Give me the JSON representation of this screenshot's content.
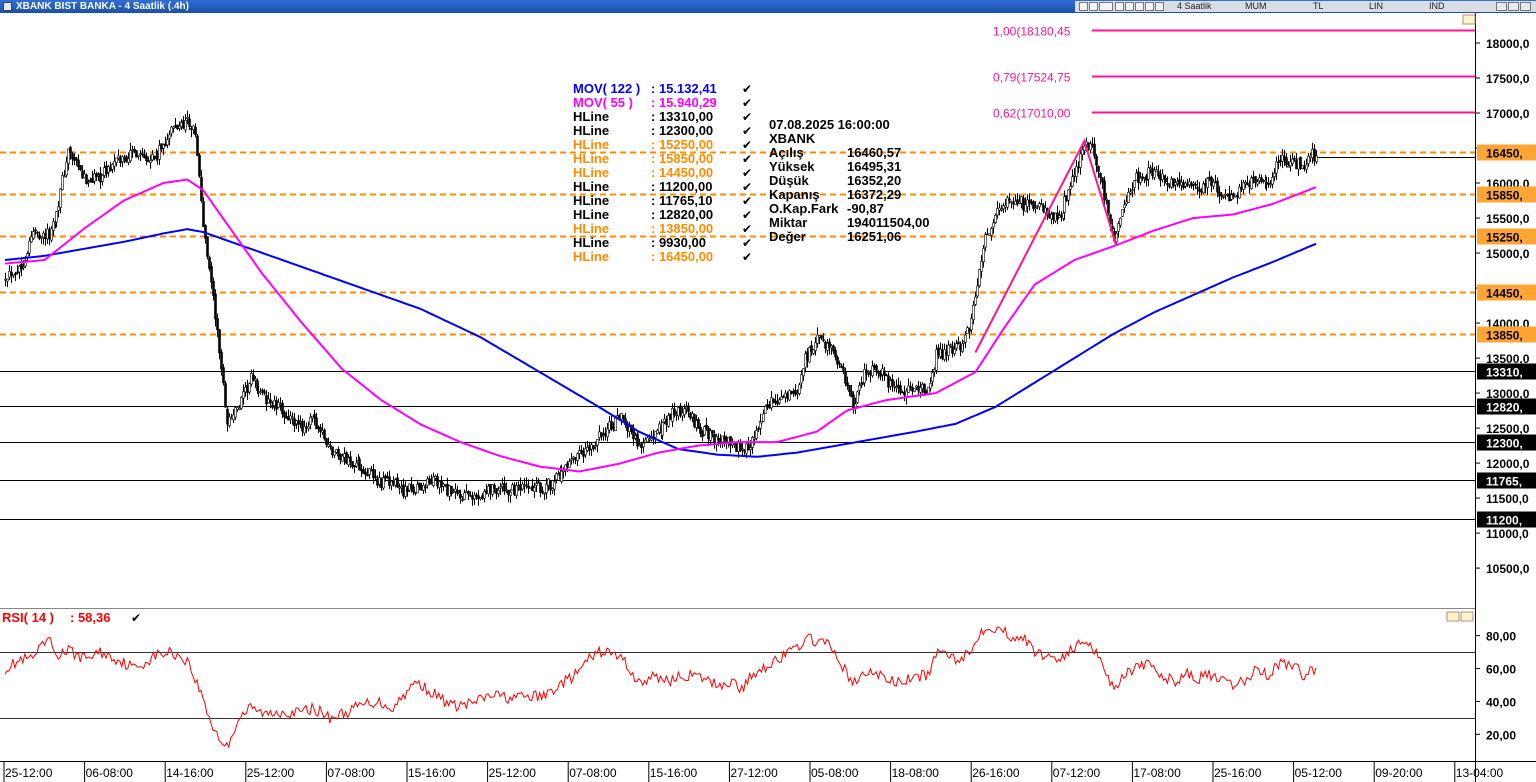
{
  "window": {
    "title": "XBANK BIST BANKA - 4 Saatlik (.4h)",
    "toolbar": {
      "period": "4 Saatlik",
      "style": "MUM",
      "currency": "TL",
      "scale": "LIN",
      "mode": "IND"
    }
  },
  "legend": {
    "mov122": {
      "label": "MOV( 122 )",
      "value": ": 15.132,41",
      "color": "#0000ff"
    },
    "mov55": {
      "label": "MOV( 55 )",
      "value": ": 15.940,29",
      "color": "#ff00ff"
    },
    "hlines": [
      {
        "label": "HLine",
        "value": ": 13310,00",
        "color": "#000000"
      },
      {
        "label": "HLine",
        "value": ": 12300,00",
        "color": "#000000"
      },
      {
        "label": "HLine",
        "value": ": 15250,00",
        "color": "#ff8c00"
      },
      {
        "label": "HLine",
        "value": ": 15850,00",
        "color": "#ff8c00"
      },
      {
        "label": "HLine",
        "value": ": 14450,00",
        "color": "#ff8c00"
      },
      {
        "label": "HLine",
        "value": ": 11200,00",
        "color": "#000000"
      },
      {
        "label": "HLine",
        "value": ": 11765,10",
        "color": "#000000"
      },
      {
        "label": "HLine",
        "value": ": 12820,00",
        "color": "#000000"
      },
      {
        "label": "HLine",
        "value": ": 13850,00",
        "color": "#ff8c00"
      },
      {
        "label": "HLine",
        "value": ": 9930,00",
        "color": "#000000"
      },
      {
        "label": "HLine",
        "value": ": 16450,00",
        "color": "#ff8c00"
      }
    ],
    "check": "✔"
  },
  "info": {
    "datetime": "07.08.2025  16:00:00",
    "symbol": "XBANK",
    "rows": [
      {
        "k": "Açılış",
        "v": "16460,57"
      },
      {
        "k": "Yüksek",
        "v": "16495,31"
      },
      {
        "k": "Düşük",
        "v": "16352,20"
      },
      {
        "k": "Kapanış",
        "v": "16372,29"
      },
      {
        "k": "O.Kap.Fark",
        "v": "-90,87"
      },
      {
        "k": "Miktar",
        "v": "194011504,00"
      },
      {
        "k": "Değer",
        "v": "16251,06"
      }
    ]
  },
  "rsi_legend": {
    "label": "RSI( 14 )",
    "value": ": 58,36",
    "color": "#ff0000"
  },
  "chart_data": {
    "type": "candlestick",
    "price_axis": {
      "ylim": [
        9930,
        18400
      ],
      "ticks": [
        18000,
        17500,
        17000,
        16500,
        16000,
        15500,
        15000,
        14500,
        14000,
        13500,
        13000,
        12500,
        12000,
        11500,
        11000,
        10500
      ],
      "tick_labels": [
        "18000,0",
        "17500,0",
        "17000,0",
        "16500,0",
        "16000,0",
        "15500,0",
        "15000,0",
        "14500,0",
        "14000,0",
        "13500,0",
        "13000,0",
        "12500,0",
        "12000,0",
        "11500,0",
        "11000,0",
        "10500,0"
      ]
    },
    "x_labels": [
      "25-12:00",
      "06-08:00",
      "14-16:00",
      "25-12:00",
      "07-08:00",
      "15-16:00",
      "25-12:00",
      "07-08:00",
      "15-16:00",
      "27-12:00",
      "05-08:00",
      "18-08:00",
      "26-16:00",
      "07-12:00",
      "17-08:00",
      "25-16:00",
      "05-12:00",
      "09-20:00",
      "13-04:00"
    ],
    "fibonacci": [
      {
        "label": "1,00(18180,45",
        "value": 18180.45
      },
      {
        "label": "0,79(17524,75",
        "value": 17524.75
      },
      {
        "label": "0,62(17010,00",
        "value": 17010.0
      }
    ],
    "hlines": [
      {
        "value": 16450,
        "label": "16450,",
        "color": "#ff8c00",
        "style": "dashed"
      },
      {
        "value": 15850,
        "label": "15850,",
        "color": "#ff8c00",
        "style": "dashed"
      },
      {
        "value": 15250,
        "label": "15250,",
        "color": "#ff8c00",
        "style": "dashed"
      },
      {
        "value": 14450,
        "label": "14450,",
        "color": "#ff8c00",
        "style": "dashed"
      },
      {
        "value": 13850,
        "label": "13850,",
        "color": "#ff8c00",
        "style": "dashed"
      },
      {
        "value": 13310,
        "label": "13310,",
        "color": "#000000",
        "style": "solid"
      },
      {
        "value": 12820,
        "label": "12820,",
        "color": "#000000",
        "style": "solid"
      },
      {
        "value": 12300,
        "label": "12300,",
        "color": "#000000",
        "style": "solid"
      },
      {
        "value": 11765,
        "label": "11765,",
        "color": "#000000",
        "style": "solid"
      },
      {
        "value": 11200,
        "label": "11200,",
        "color": "#000000",
        "style": "solid"
      }
    ],
    "close_keypoints": [
      [
        0,
        14700
      ],
      [
        8,
        14800
      ],
      [
        14,
        15300
      ],
      [
        22,
        15250
      ],
      [
        26,
        15600
      ],
      [
        32,
        16450
      ],
      [
        40,
        16050
      ],
      [
        48,
        16100
      ],
      [
        56,
        16300
      ],
      [
        66,
        16450
      ],
      [
        76,
        16350
      ],
      [
        84,
        16750
      ],
      [
        92,
        16900
      ],
      [
        96,
        16700
      ],
      [
        100,
        15400
      ],
      [
        104,
        14600
      ],
      [
        108,
        13600
      ],
      [
        112,
        12600
      ],
      [
        118,
        12800
      ],
      [
        124,
        13200
      ],
      [
        132,
        12900
      ],
      [
        140,
        12750
      ],
      [
        148,
        12500
      ],
      [
        156,
        12600
      ],
      [
        164,
        12200
      ],
      [
        172,
        12050
      ],
      [
        180,
        11950
      ],
      [
        188,
        11750
      ],
      [
        196,
        11700
      ],
      [
        202,
        11600
      ],
      [
        208,
        11650
      ],
      [
        216,
        11750
      ],
      [
        226,
        11550
      ],
      [
        236,
        11500
      ],
      [
        246,
        11650
      ],
      [
        256,
        11600
      ],
      [
        264,
        11620
      ],
      [
        272,
        11650
      ],
      [
        280,
        11800
      ],
      [
        288,
        12050
      ],
      [
        296,
        12200
      ],
      [
        302,
        12450
      ],
      [
        312,
        12650
      ],
      [
        320,
        12250
      ],
      [
        328,
        12400
      ],
      [
        336,
        12700
      ],
      [
        344,
        12750
      ],
      [
        352,
        12450
      ],
      [
        360,
        12350
      ],
      [
        368,
        12250
      ],
      [
        372,
        12150
      ],
      [
        378,
        12350
      ],
      [
        386,
        12850
      ],
      [
        394,
        12950
      ],
      [
        400,
        13000
      ],
      [
        404,
        13500
      ],
      [
        410,
        13750
      ],
      [
        416,
        13700
      ],
      [
        422,
        13350
      ],
      [
        428,
        12800
      ],
      [
        432,
        13150
      ],
      [
        436,
        13350
      ],
      [
        442,
        13300
      ],
      [
        448,
        13050
      ],
      [
        454,
        13000
      ],
      [
        460,
        13100
      ],
      [
        466,
        13000
      ],
      [
        470,
        13550
      ],
      [
        476,
        13600
      ],
      [
        480,
        13650
      ],
      [
        484,
        13750
      ],
      [
        488,
        14000
      ],
      [
        492,
        14800
      ],
      [
        496,
        15300
      ],
      [
        502,
        15600
      ],
      [
        508,
        15800
      ],
      [
        514,
        15700
      ],
      [
        520,
        15650
      ],
      [
        526,
        15600
      ],
      [
        532,
        15500
      ],
      [
        540,
        16100
      ],
      [
        544,
        16500
      ],
      [
        548,
        16550
      ],
      [
        552,
        16200
      ],
      [
        556,
        15700
      ],
      [
        560,
        15200
      ],
      [
        564,
        15600
      ],
      [
        570,
        16050
      ],
      [
        578,
        16150
      ],
      [
        584,
        16100
      ],
      [
        590,
        15950
      ],
      [
        596,
        16000
      ],
      [
        602,
        15900
      ],
      [
        608,
        16050
      ],
      [
        614,
        15850
      ],
      [
        620,
        15800
      ],
      [
        626,
        15950
      ],
      [
        632,
        16100
      ],
      [
        638,
        16000
      ],
      [
        644,
        16350
      ],
      [
        650,
        16300
      ],
      [
        656,
        16250
      ],
      [
        660,
        16400
      ],
      [
        662,
        16372.29
      ]
    ],
    "mov122_keypoints": [
      [
        0,
        14900
      ],
      [
        20,
        14960
      ],
      [
        40,
        15060
      ],
      [
        60,
        15160
      ],
      [
        80,
        15280
      ],
      [
        92,
        15340
      ],
      [
        100,
        15300
      ],
      [
        120,
        15100
      ],
      [
        150,
        14800
      ],
      [
        180,
        14500
      ],
      [
        210,
        14200
      ],
      [
        240,
        13800
      ],
      [
        270,
        13300
      ],
      [
        300,
        12800
      ],
      [
        320,
        12450
      ],
      [
        340,
        12200
      ],
      [
        360,
        12120
      ],
      [
        380,
        12090
      ],
      [
        400,
        12150
      ],
      [
        420,
        12250
      ],
      [
        440,
        12350
      ],
      [
        460,
        12450
      ],
      [
        480,
        12560
      ],
      [
        500,
        12800
      ],
      [
        520,
        13150
      ],
      [
        540,
        13500
      ],
      [
        560,
        13850
      ],
      [
        580,
        14150
      ],
      [
        600,
        14400
      ],
      [
        620,
        14650
      ],
      [
        640,
        14870
      ],
      [
        662,
        15132.41
      ]
    ],
    "mov55_keypoints": [
      [
        0,
        14850
      ],
      [
        20,
        14900
      ],
      [
        40,
        15350
      ],
      [
        60,
        15750
      ],
      [
        80,
        16000
      ],
      [
        92,
        16050
      ],
      [
        100,
        15900
      ],
      [
        110,
        15500
      ],
      [
        130,
        14700
      ],
      [
        150,
        14000
      ],
      [
        170,
        13350
      ],
      [
        190,
        12900
      ],
      [
        210,
        12550
      ],
      [
        230,
        12300
      ],
      [
        250,
        12100
      ],
      [
        270,
        11950
      ],
      [
        290,
        11880
      ],
      [
        310,
        11990
      ],
      [
        330,
        12150
      ],
      [
        350,
        12250
      ],
      [
        370,
        12300
      ],
      [
        390,
        12300
      ],
      [
        410,
        12450
      ],
      [
        425,
        12750
      ],
      [
        445,
        12900
      ],
      [
        470,
        13000
      ],
      [
        490,
        13300
      ],
      [
        505,
        13950
      ],
      [
        520,
        14550
      ],
      [
        540,
        14900
      ],
      [
        560,
        15100
      ],
      [
        580,
        15320
      ],
      [
        600,
        15500
      ],
      [
        620,
        15550
      ],
      [
        640,
        15700
      ],
      [
        662,
        15940.29
      ]
    ],
    "zigzag": [
      [
        490,
        13580
      ],
      [
        545,
        16600
      ],
      [
        561,
        15120
      ]
    ],
    "rsi": {
      "ticks": [
        80,
        60,
        40,
        20
      ],
      "tick_labels": [
        "80,00",
        "60,00",
        "40,00",
        "20,00"
      ],
      "levels": [
        70,
        30
      ],
      "ylim": [
        5,
        95
      ],
      "keypoints": [
        [
          0,
          60
        ],
        [
          8,
          65
        ],
        [
          14,
          66
        ],
        [
          22,
          78
        ],
        [
          26,
          68
        ],
        [
          32,
          71
        ],
        [
          40,
          66
        ],
        [
          48,
          70
        ],
        [
          56,
          66
        ],
        [
          66,
          60
        ],
        [
          76,
          68
        ],
        [
          84,
          70
        ],
        [
          92,
          65
        ],
        [
          100,
          42
        ],
        [
          104,
          27
        ],
        [
          108,
          18
        ],
        [
          112,
          12
        ],
        [
          118,
          30
        ],
        [
          124,
          36
        ],
        [
          132,
          32
        ],
        [
          140,
          34
        ],
        [
          148,
          33
        ],
        [
          156,
          36
        ],
        [
          164,
          30
        ],
        [
          172,
          33
        ],
        [
          180,
          38
        ],
        [
          188,
          40
        ],
        [
          196,
          36
        ],
        [
          202,
          45
        ],
        [
          208,
          52
        ],
        [
          216,
          45
        ],
        [
          226,
          37
        ],
        [
          236,
          39
        ],
        [
          246,
          44
        ],
        [
          256,
          42
        ],
        [
          264,
          43
        ],
        [
          272,
          43
        ],
        [
          280,
          50
        ],
        [
          288,
          56
        ],
        [
          296,
          67
        ],
        [
          302,
          71
        ],
        [
          312,
          66
        ],
        [
          320,
          51
        ],
        [
          328,
          55
        ],
        [
          336,
          53
        ],
        [
          344,
          56
        ],
        [
          352,
          54
        ],
        [
          360,
          50
        ],
        [
          368,
          52
        ],
        [
          372,
          47
        ],
        [
          378,
          57
        ],
        [
          386,
          63
        ],
        [
          394,
          68
        ],
        [
          400,
          73
        ],
        [
          404,
          78
        ],
        [
          410,
          77
        ],
        [
          416,
          74
        ],
        [
          422,
          64
        ],
        [
          428,
          50
        ],
        [
          432,
          55
        ],
        [
          436,
          58
        ],
        [
          442,
          56
        ],
        [
          448,
          52
        ],
        [
          454,
          52
        ],
        [
          460,
          55
        ],
        [
          466,
          56
        ],
        [
          470,
          68
        ],
        [
          476,
          70
        ],
        [
          480,
          66
        ],
        [
          484,
          68
        ],
        [
          488,
          70
        ],
        [
          492,
          82
        ],
        [
          496,
          86
        ],
        [
          502,
          84
        ],
        [
          508,
          80
        ],
        [
          514,
          79
        ],
        [
          520,
          70
        ],
        [
          526,
          68
        ],
        [
          532,
          66
        ],
        [
          540,
          72
        ],
        [
          544,
          77
        ],
        [
          548,
          76
        ],
        [
          552,
          68
        ],
        [
          556,
          58
        ],
        [
          560,
          47
        ],
        [
          564,
          56
        ],
        [
          570,
          60
        ],
        [
          578,
          62
        ],
        [
          584,
          56
        ],
        [
          590,
          52
        ],
        [
          596,
          57
        ],
        [
          602,
          54
        ],
        [
          608,
          56
        ],
        [
          614,
          52
        ],
        [
          620,
          50
        ],
        [
          626,
          52
        ],
        [
          632,
          60
        ],
        [
          638,
          56
        ],
        [
          644,
          64
        ],
        [
          650,
          62
        ],
        [
          656,
          56
        ],
        [
          660,
          60
        ],
        [
          662,
          58.36
        ]
      ]
    }
  }
}
